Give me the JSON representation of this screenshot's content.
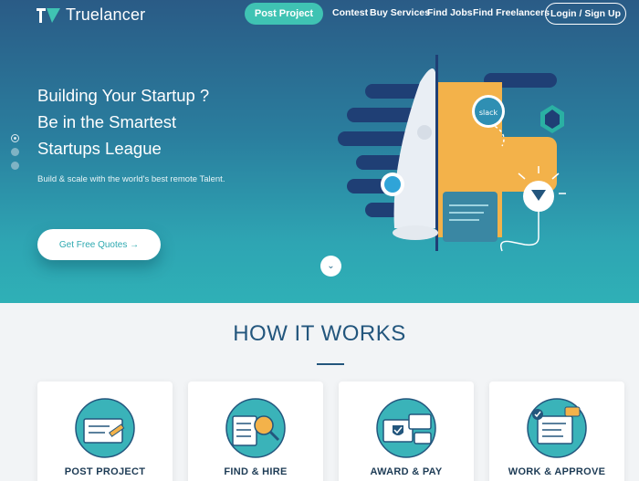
{
  "brand": {
    "name": "Truelancer",
    "color": "#ffffff"
  },
  "nav": {
    "post_project": "Post Project",
    "links": [
      "Contest",
      "Buy Services",
      "Find Jobs",
      "Find Freelancers"
    ],
    "login": "Login / Sign Up"
  },
  "hero": {
    "title_lines": [
      "Building Your Startup ?",
      "Be in the Smartest",
      "Startups League"
    ],
    "subtitle": "Build & scale with the world's best remote Talent.",
    "cta": "Get Free Quotes →",
    "slide_count": 3,
    "active_slide": 1,
    "badges": [
      "slack"
    ]
  },
  "how_it_works": {
    "title": "HOW IT WORKS",
    "steps": [
      {
        "label": "POST PROJECT",
        "icon": "post-project-icon"
      },
      {
        "label": "FIND & HIRE",
        "icon": "find-hire-icon"
      },
      {
        "label": "AWARD & PAY",
        "icon": "award-pay-icon"
      },
      {
        "label": "WORK & APPROVE",
        "icon": "work-approve-icon"
      }
    ]
  },
  "colors": {
    "accent": "#3fc3b3",
    "navy": "#23567d",
    "teal": "#2fb0b6"
  }
}
